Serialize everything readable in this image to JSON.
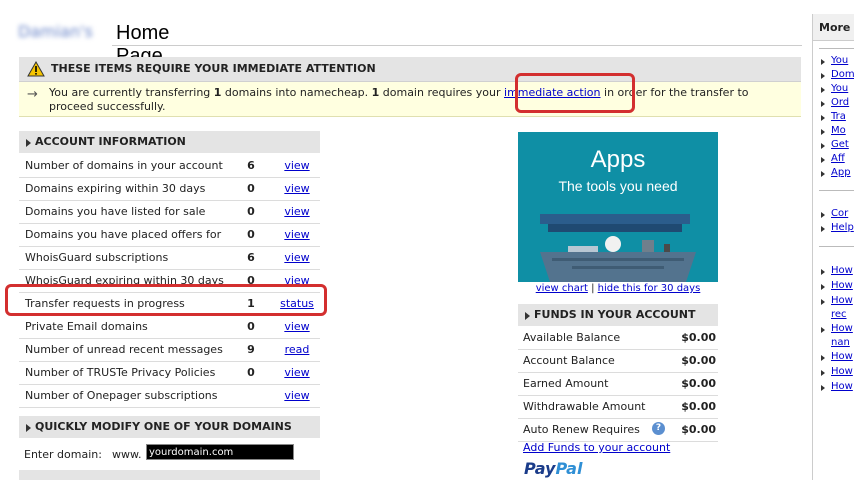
{
  "header": {
    "user_name": "Damian's",
    "title": "Home Page"
  },
  "attention": {
    "title": "THESE ITEMS REQUIRE YOUR IMMEDIATE ATTENTION",
    "msg_part1": "You are currently transferring ",
    "msg_count1": "1",
    "msg_part2": " domains into namecheap. ",
    "msg_count2": "1",
    "msg_part3": " domain requires your ",
    "msg_link": "immediate action",
    "msg_part4": " in order for the transfer to proceed successfully."
  },
  "account": {
    "heading": "ACCOUNT INFORMATION",
    "rows": [
      {
        "label": "Number of domains in your account",
        "count": "6",
        "action": "view"
      },
      {
        "label": "Domains expiring within 30 days",
        "count": "0",
        "action": "view"
      },
      {
        "label": "Domains you have listed for sale",
        "count": "0",
        "action": "view"
      },
      {
        "label": "Domains you have placed offers for",
        "count": "0",
        "action": "view"
      },
      {
        "label": "WhoisGuard subscriptions",
        "count": "6",
        "action": "view"
      },
      {
        "label": "WhoisGuard expiring within 30 days",
        "count": "0",
        "action": "view"
      },
      {
        "label": "Transfer requests in progress",
        "count": "1",
        "action": "status"
      },
      {
        "label": "Private Email domains",
        "count": "0",
        "action": "view"
      },
      {
        "label": "Number of unread recent messages",
        "count": "9",
        "action": "read"
      },
      {
        "label": "Number of TRUSTe Privacy Policies",
        "count": "0",
        "action": "view"
      },
      {
        "label": "Number of Onepager subscriptions",
        "count": "",
        "action": "view"
      }
    ]
  },
  "quick_modify": {
    "heading": "QUICKLY MODIFY ONE OF YOUR DOMAINS",
    "enter_label": "Enter domain:",
    "www_label": "www.",
    "input_value": "yourdomain.com"
  },
  "banner": {
    "title": "Apps",
    "subtitle": "The tools you need",
    "link_chart": "view chart",
    "separator": " | ",
    "link_hide": "hide this for 30 days"
  },
  "funds": {
    "heading": "FUNDS IN YOUR ACCOUNT",
    "rows": [
      {
        "label": "Available Balance",
        "value": "$0.00"
      },
      {
        "label": "Account Balance",
        "value": "$0.00"
      },
      {
        "label": "Earned Amount",
        "value": "$0.00"
      },
      {
        "label": "Withdrawable Amount",
        "value": "$0.00"
      },
      {
        "label": "Auto Renew Requires",
        "value": "$0.00"
      }
    ],
    "help_glyph": "?",
    "add_funds": "Add Funds to your account",
    "paypal_1": "Pay",
    "paypal_2": "Pal"
  },
  "sidebar": {
    "title": "More L",
    "group1": [
      "You",
      "Dom",
      "You",
      "Ord",
      "Tra",
      "Mo",
      "Get",
      "Aff",
      "App"
    ],
    "group2": [
      "Cor",
      "Help"
    ],
    "group3": [
      "How",
      "How",
      "How",
      "rec",
      "How",
      "nan",
      "How",
      "How",
      "How"
    ]
  },
  "colors": {
    "link": "#0000cc",
    "highlight": "#d32f2f",
    "banner": "#0f8fa5",
    "attention_bg": "#ffffe0"
  }
}
